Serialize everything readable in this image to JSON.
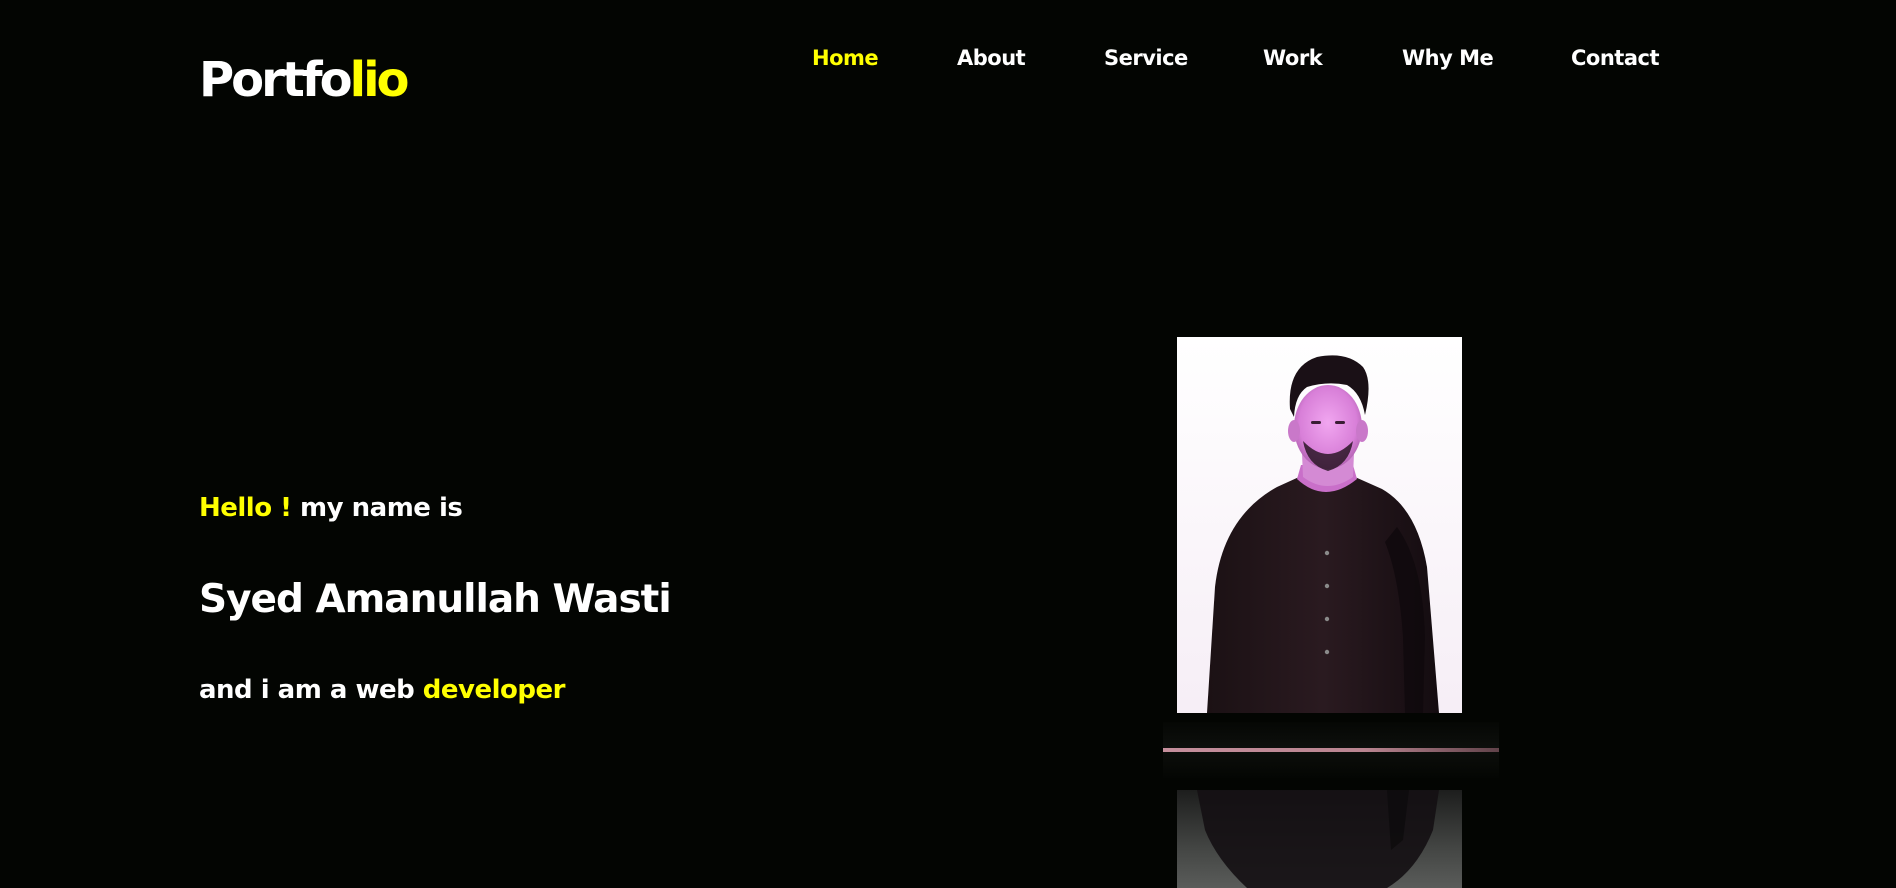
{
  "logo": {
    "main": "Portfo",
    "accent": "lio"
  },
  "nav": {
    "items": [
      {
        "label": "Home",
        "active": true
      },
      {
        "label": "About",
        "active": false
      },
      {
        "label": "Service",
        "active": false
      },
      {
        "label": "Work",
        "active": false
      },
      {
        "label": "Why Me",
        "active": false
      },
      {
        "label": "Contact",
        "active": false
      }
    ]
  },
  "hero": {
    "greeting_accent": "Hello !",
    "greeting_rest": " my name is",
    "name": "Syed Amanullah Wasti",
    "role_prefix": "and i am a web ",
    "role_accent": "developer"
  },
  "colors": {
    "background": "#030502",
    "accent": "#ffff00",
    "text": "#ffffff"
  }
}
